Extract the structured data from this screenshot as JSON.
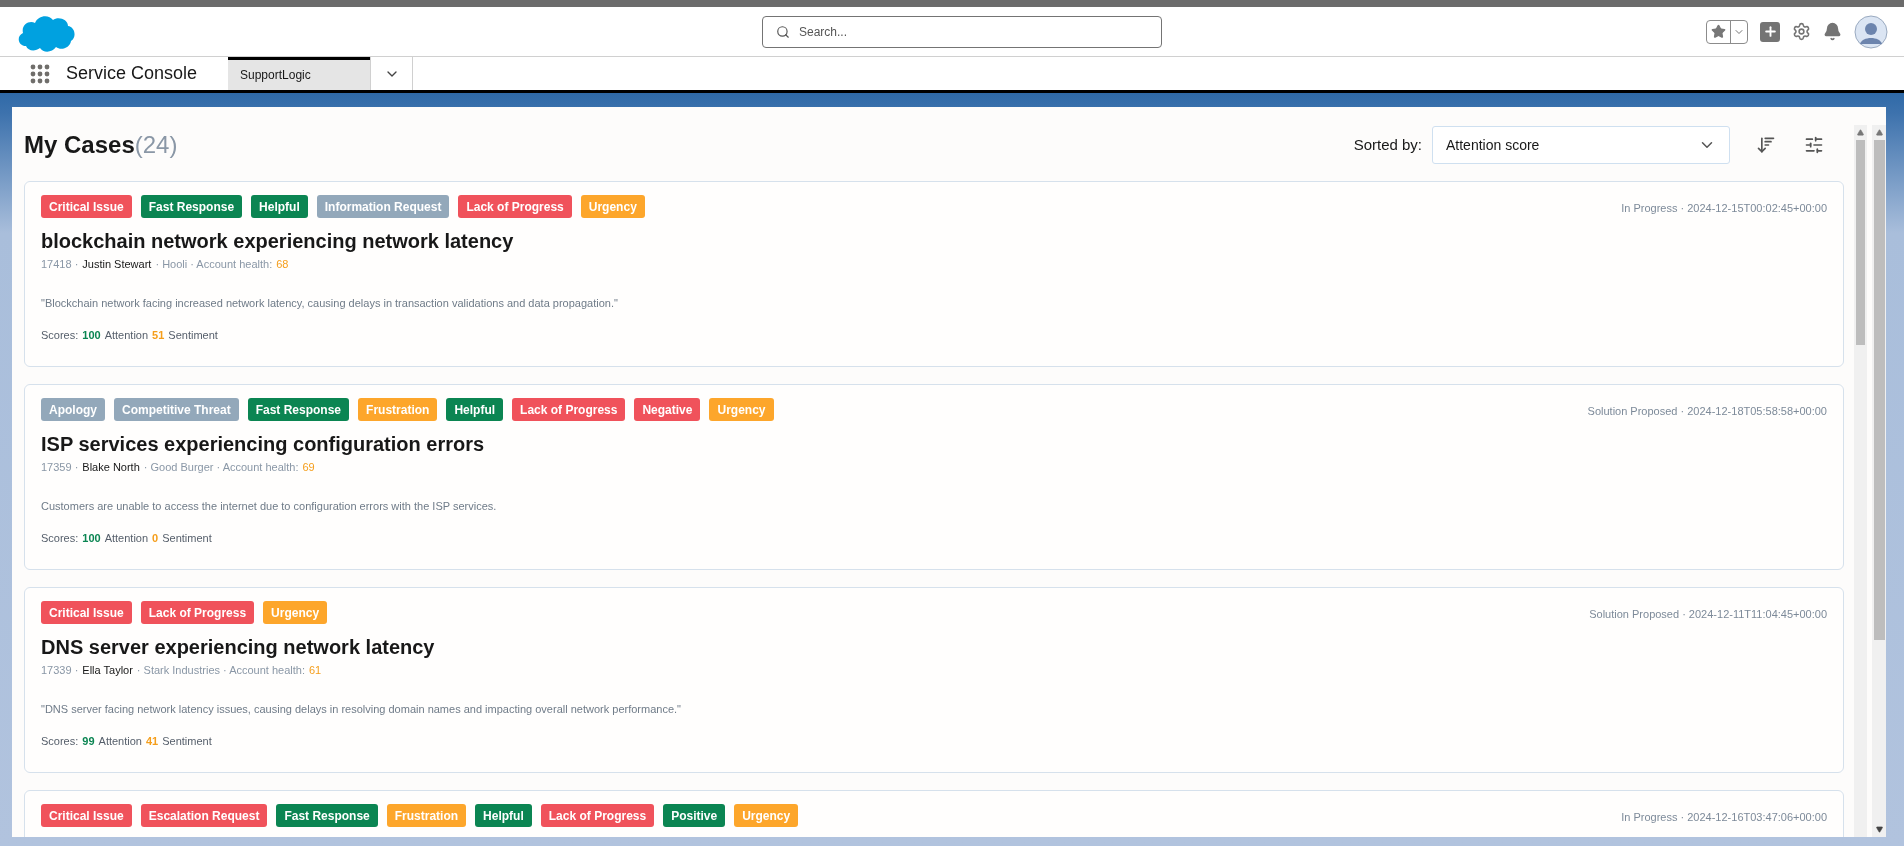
{
  "header": {
    "search": {
      "placeholder": "Search..."
    }
  },
  "nav": {
    "app_name": "Service Console",
    "tabs": [
      {
        "label": "SupportLogic",
        "selected": true
      }
    ]
  },
  "page": {
    "title": "My Cases",
    "count": "(24)",
    "sort_label": "Sorted by:",
    "sort_value": "Attention score"
  },
  "cases": [
    {
      "tags": [
        {
          "label": "Critical Issue",
          "color": "#f0525b"
        },
        {
          "label": "Fast Response",
          "color": "#0b8552"
        },
        {
          "label": "Helpful",
          "color": "#0b8552"
        },
        {
          "label": "Information Request",
          "color": "#93a8ba"
        },
        {
          "label": "Lack of Progress",
          "color": "#f0525b"
        },
        {
          "label": "Urgency",
          "color": "#fda62b"
        }
      ],
      "status": "In Progress · 2024-12-15T00:02:45+00:00",
      "title": "blockchain network experiencing network latency",
      "meta": [
        {
          "kind": "muted",
          "text": "17418 ·"
        },
        {
          "kind": "name",
          "text": "Justin Stewart"
        },
        {
          "kind": "muted",
          "text": "· Hooli · Account health:"
        },
        {
          "kind": "warn",
          "text": "68"
        }
      ],
      "description": "\"Blockchain network facing increased network latency, causing delays in transaction validations and data propagation.\"",
      "scores": [
        {
          "kind": "label",
          "text": "Scores:"
        },
        {
          "kind": "good",
          "text": "100"
        },
        {
          "kind": "label",
          "text": "Attention"
        },
        {
          "kind": "warn",
          "text": "51"
        },
        {
          "kind": "label",
          "text": "Sentiment"
        }
      ]
    },
    {
      "tags": [
        {
          "label": "Apology",
          "color": "#93a8ba"
        },
        {
          "label": "Competitive Threat",
          "color": "#93a8ba"
        },
        {
          "label": "Fast Response",
          "color": "#0b8552"
        },
        {
          "label": "Frustration",
          "color": "#fda62b"
        },
        {
          "label": "Helpful",
          "color": "#0b8552"
        },
        {
          "label": "Lack of Progress",
          "color": "#f0525b"
        },
        {
          "label": "Negative",
          "color": "#f0525b"
        },
        {
          "label": "Urgency",
          "color": "#fda62b"
        }
      ],
      "status": "Solution Proposed · 2024-12-18T05:58:58+00:00",
      "title": "ISP services experiencing configuration errors",
      "meta": [
        {
          "kind": "muted",
          "text": "17359 ·"
        },
        {
          "kind": "name",
          "text": "Blake North"
        },
        {
          "kind": "muted",
          "text": "· Good Burger · Account health:"
        },
        {
          "kind": "warn",
          "text": "69"
        }
      ],
      "description": "Customers are unable to access the internet due to configuration errors with the ISP services.",
      "scores": [
        {
          "kind": "label",
          "text": "Scores:"
        },
        {
          "kind": "good",
          "text": "100"
        },
        {
          "kind": "label",
          "text": "Attention"
        },
        {
          "kind": "warn",
          "text": "0"
        },
        {
          "kind": "label",
          "text": "Sentiment"
        }
      ]
    },
    {
      "tags": [
        {
          "label": "Critical Issue",
          "color": "#f0525b"
        },
        {
          "label": "Lack of Progress",
          "color": "#f0525b"
        },
        {
          "label": "Urgency",
          "color": "#fda62b"
        }
      ],
      "status": "Solution Proposed · 2024-12-11T11:04:45+00:00",
      "title": "DNS server experiencing network latency",
      "meta": [
        {
          "kind": "muted",
          "text": "17339 ·"
        },
        {
          "kind": "name",
          "text": "Ella Taylor"
        },
        {
          "kind": "muted",
          "text": "· Stark Industries · Account health:"
        },
        {
          "kind": "warn",
          "text": "61"
        }
      ],
      "description": "\"DNS server facing network latency issues, causing delays in resolving domain names and impacting overall network performance.\"",
      "scores": [
        {
          "kind": "label",
          "text": "Scores:"
        },
        {
          "kind": "good",
          "text": "99"
        },
        {
          "kind": "label",
          "text": "Attention"
        },
        {
          "kind": "warn",
          "text": "41"
        },
        {
          "kind": "label",
          "text": "Sentiment"
        }
      ]
    },
    {
      "tags": [
        {
          "label": "Critical Issue",
          "color": "#f0525b"
        },
        {
          "label": "Escalation Request",
          "color": "#f0525b"
        },
        {
          "label": "Fast Response",
          "color": "#0b8552"
        },
        {
          "label": "Frustration",
          "color": "#fda62b"
        },
        {
          "label": "Helpful",
          "color": "#0b8552"
        },
        {
          "label": "Lack of Progress",
          "color": "#f0525b"
        },
        {
          "label": "Positive",
          "color": "#0b8552"
        },
        {
          "label": "Urgency",
          "color": "#fda62b"
        }
      ],
      "status": "In Progress · 2024-12-16T03:47:06+00:00"
    }
  ]
}
